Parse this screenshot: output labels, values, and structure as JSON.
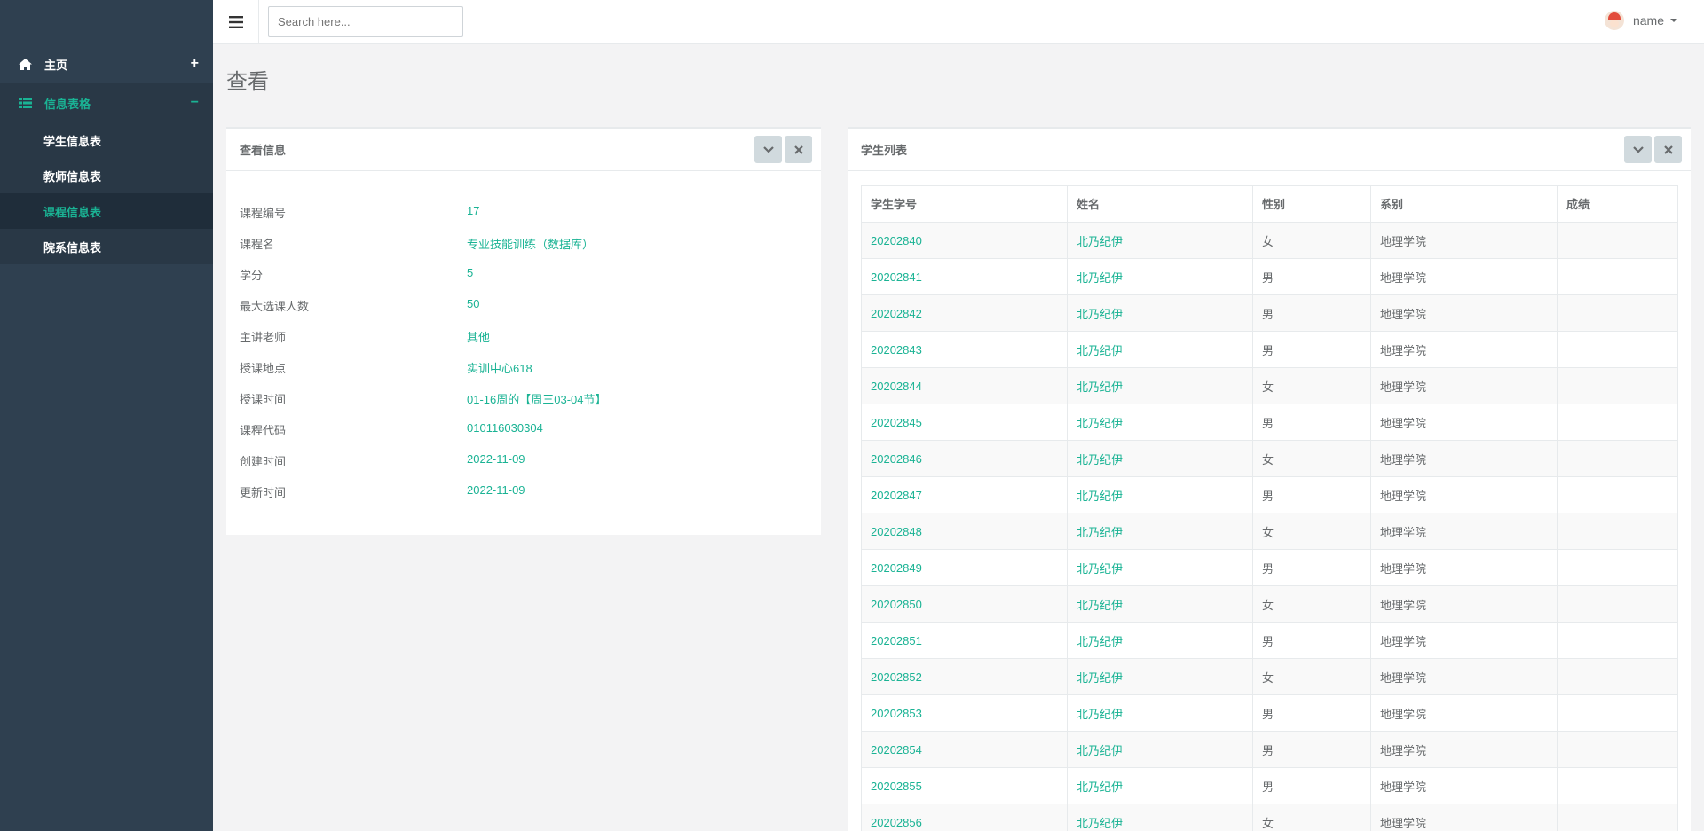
{
  "sidebar": {
    "home": {
      "label": "主页",
      "sign": "+"
    },
    "tables": {
      "label": "信息表格",
      "sign": "−"
    },
    "sub_items": [
      "学生信息表",
      "教师信息表",
      "课程信息表",
      "院系信息表"
    ]
  },
  "topbar": {
    "search_placeholder": "Search here...",
    "user_name": "name"
  },
  "page": {
    "title": "查看"
  },
  "info_panel": {
    "title": "查看信息",
    "rows": [
      {
        "label": "课程编号",
        "value": "17"
      },
      {
        "label": "课程名",
        "value": "专业技能训练（数据库）"
      },
      {
        "label": "学分",
        "value": "5"
      },
      {
        "label": "最大选课人数",
        "value": "50"
      },
      {
        "label": "主讲老师",
        "value": "其他"
      },
      {
        "label": "授课地点",
        "value": "实训中心618"
      },
      {
        "label": "授课时间",
        "value": "01-16周的【周三03-04节】"
      },
      {
        "label": "课程代码",
        "value": "010116030304"
      },
      {
        "label": "创建时间",
        "value": "2022-11-09"
      },
      {
        "label": "更新时间",
        "value": "2022-11-09"
      }
    ]
  },
  "student_panel": {
    "title": "学生列表",
    "columns": [
      "学生学号",
      "姓名",
      "性别",
      "系别",
      "成绩"
    ],
    "rows": [
      [
        "20202840",
        "北乃纪伊",
        "女",
        "地理学院",
        ""
      ],
      [
        "20202841",
        "北乃纪伊",
        "男",
        "地理学院",
        ""
      ],
      [
        "20202842",
        "北乃纪伊",
        "男",
        "地理学院",
        ""
      ],
      [
        "20202843",
        "北乃纪伊",
        "男",
        "地理学院",
        ""
      ],
      [
        "20202844",
        "北乃纪伊",
        "女",
        "地理学院",
        ""
      ],
      [
        "20202845",
        "北乃纪伊",
        "男",
        "地理学院",
        ""
      ],
      [
        "20202846",
        "北乃纪伊",
        "女",
        "地理学院",
        ""
      ],
      [
        "20202847",
        "北乃纪伊",
        "男",
        "地理学院",
        ""
      ],
      [
        "20202848",
        "北乃纪伊",
        "女",
        "地理学院",
        ""
      ],
      [
        "20202849",
        "北乃纪伊",
        "男",
        "地理学院",
        ""
      ],
      [
        "20202850",
        "北乃纪伊",
        "女",
        "地理学院",
        ""
      ],
      [
        "20202851",
        "北乃纪伊",
        "男",
        "地理学院",
        ""
      ],
      [
        "20202852",
        "北乃纪伊",
        "女",
        "地理学院",
        ""
      ],
      [
        "20202853",
        "北乃纪伊",
        "男",
        "地理学院",
        ""
      ],
      [
        "20202854",
        "北乃纪伊",
        "男",
        "地理学院",
        ""
      ],
      [
        "20202855",
        "北乃纪伊",
        "男",
        "地理学院",
        ""
      ],
      [
        "20202856",
        "北乃纪伊",
        "女",
        "地理学院",
        ""
      ]
    ]
  },
  "colors": {
    "accent": "#1ab394",
    "sidebar_bg": "#2f4050"
  },
  "icons": [
    "home-icon",
    "table-icon",
    "hamburger-icon",
    "chevron-down-icon",
    "close-icon",
    "avatar"
  ]
}
